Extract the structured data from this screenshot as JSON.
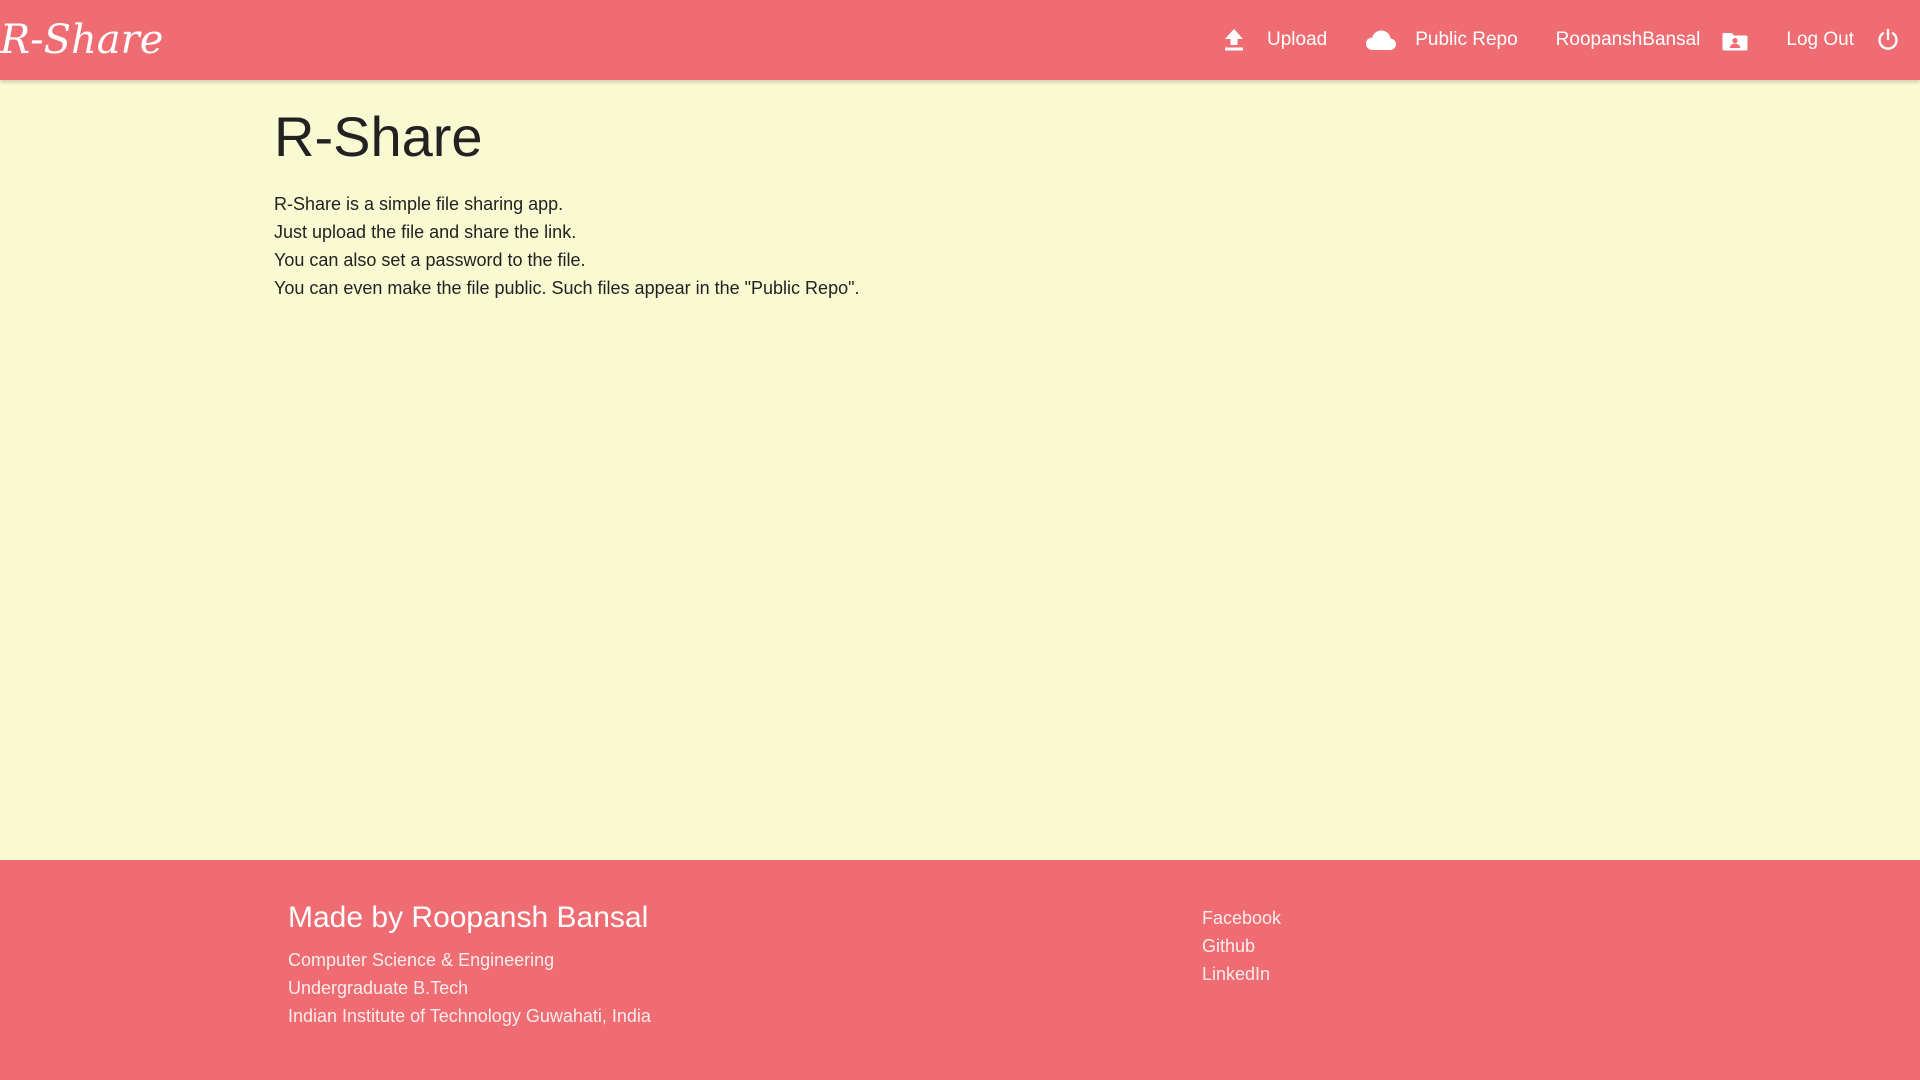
{
  "navbar": {
    "brand": "R-Share",
    "upload_label": "Upload",
    "public_repo_label": "Public Repo",
    "username": "RoopanshBansal",
    "logout_label": "Log Out",
    "bg_color": "#ef6c73"
  },
  "main": {
    "title": "R-Share",
    "lines": [
      "R-Share is a simple file sharing app.",
      "Just upload the file and share the link.",
      "You can also set a password to the file.",
      "You can even make the file public. Such files appear in the \"Public Repo\"."
    ],
    "bg_color": "#f9f9d2"
  },
  "footer": {
    "title": "Made by Roopansh Bansal",
    "info": [
      "Computer Science & Engineering",
      "Undergraduate B.Tech",
      "Indian Institute of Technology Guwahati, India"
    ],
    "links": [
      "Facebook",
      "Github",
      "LinkedIn"
    ]
  },
  "icons": {
    "upload": "upload-icon",
    "public_repo": "cloud-icon",
    "user": "account-box-icon",
    "logout": "power-icon"
  }
}
